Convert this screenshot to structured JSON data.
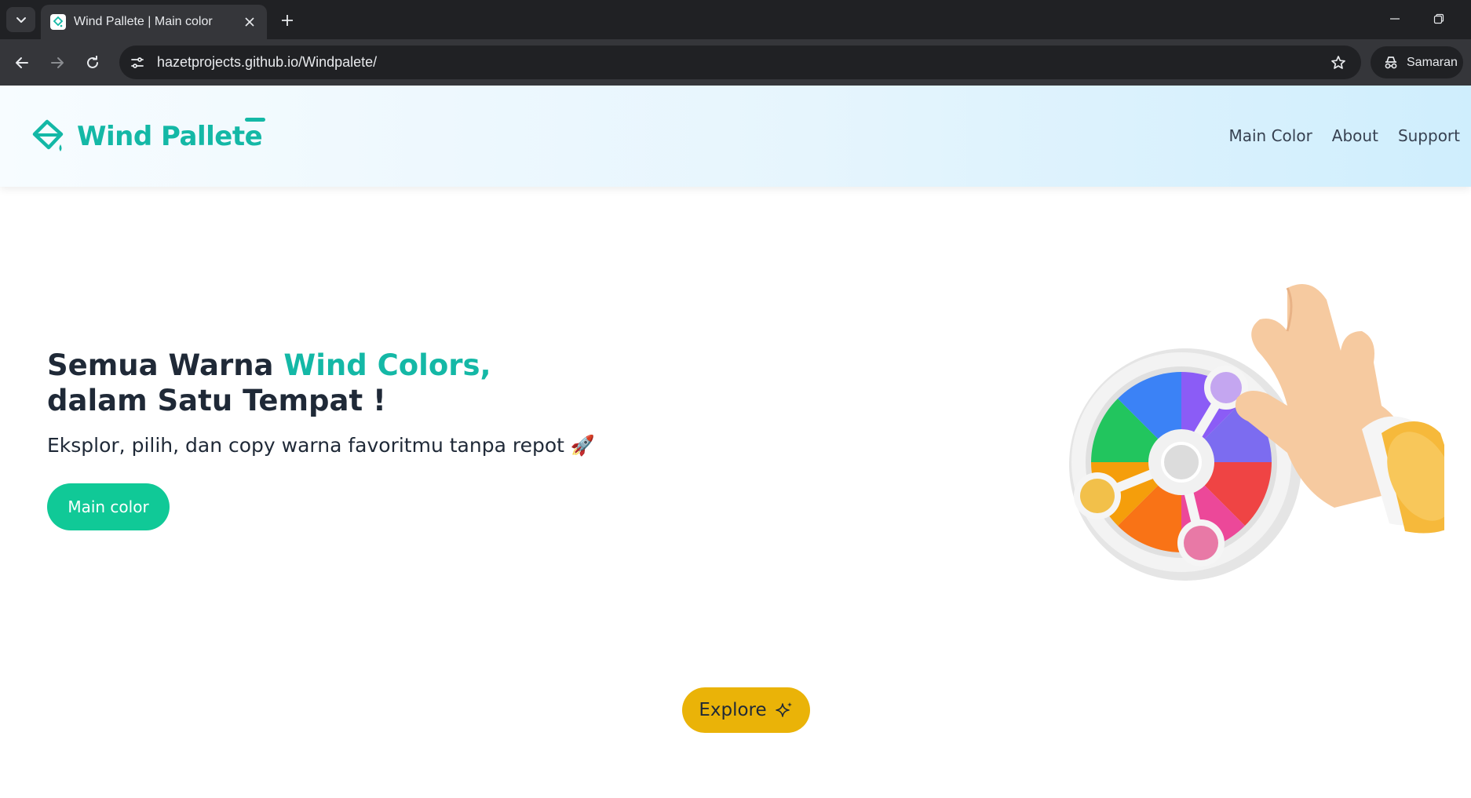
{
  "browser": {
    "tab_title": "Wind Pallete | Main color",
    "url": "hazetprojects.github.io/Windpalete/",
    "profile_label": "Samaran",
    "icons": [
      "tab-list-icon",
      "site-favicon",
      "close-icon",
      "plus-icon",
      "minimize-icon",
      "restore-icon",
      "back-icon",
      "forward-icon",
      "reload-icon",
      "site-info-icon",
      "star-icon",
      "incognito-icon"
    ]
  },
  "header": {
    "logo_text": "Wind Pallete",
    "nav": [
      "Main Color",
      "About",
      "Support"
    ]
  },
  "hero": {
    "title_line1_plain": "Semua Warna ",
    "title_line1_accent": "Wind Colors,",
    "title_line2": "dalam Satu Tempat !",
    "subtitle": "Eksplor, pilih, dan copy warna favoritmu tanpa repot 🚀",
    "primary_button": "Main color"
  },
  "explore_button": "Explore",
  "colors": {
    "brand_teal": "#14b8a6",
    "button_green": "#10c997",
    "explore_yellow": "#eab308",
    "text_dark": "#1f2937"
  }
}
